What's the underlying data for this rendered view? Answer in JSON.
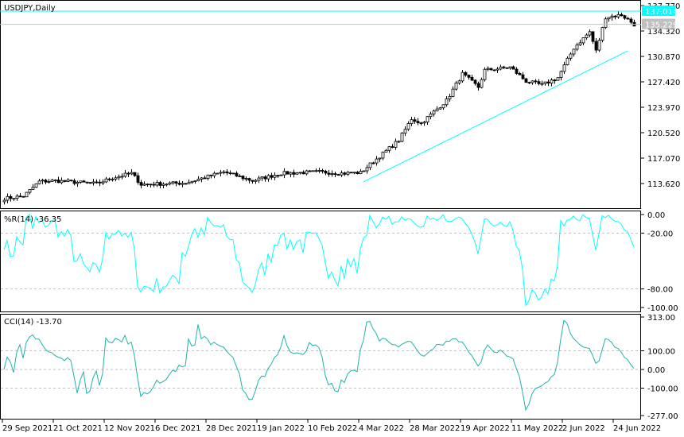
{
  "main": {
    "title": "USDJPY,Daily",
    "price_labels": [
      "137.770",
      "134.320",
      "130.870",
      "127.420",
      "123.970",
      "120.520",
      "117.070",
      "113.620"
    ],
    "price_values": [
      137.77,
      134.32,
      130.87,
      127.42,
      123.97,
      120.52,
      117.07,
      113.62
    ],
    "hline_price": {
      "label": "137.014",
      "value": 137.014
    },
    "current_price": {
      "label": "135.229",
      "value": 135.229
    },
    "trendline": {
      "from_bar": 113,
      "from_price": 113.85,
      "to_bar": 196,
      "to_price": 131.6
    },
    "price_keypoints": [
      [
        0,
        111.6
      ],
      [
        6,
        111.9
      ],
      [
        11,
        113.9
      ],
      [
        16,
        114.0
      ],
      [
        29,
        113.6
      ],
      [
        34,
        114.4
      ],
      [
        40,
        115.0
      ],
      [
        43,
        113.5
      ],
      [
        57,
        113.7
      ],
      [
        69,
        115.2
      ],
      [
        78,
        114.0
      ],
      [
        87,
        115.0
      ],
      [
        99,
        115.2
      ],
      [
        106,
        115.0
      ],
      [
        112,
        115.1
      ],
      [
        116,
        116.6
      ],
      [
        124,
        119.5
      ],
      [
        128,
        122.4
      ],
      [
        131,
        121.8
      ],
      [
        139,
        124.9
      ],
      [
        144,
        128.5
      ],
      [
        149,
        126.7
      ],
      [
        151,
        129.0
      ],
      [
        159,
        129.4
      ],
      [
        164,
        127.5
      ],
      [
        169,
        127.0
      ],
      [
        174,
        128.0
      ],
      [
        179,
        132.0
      ],
      [
        184,
        134.2
      ],
      [
        186,
        131.6
      ],
      [
        189,
        136.2
      ],
      [
        194,
        136.5
      ],
      [
        198,
        135.2
      ]
    ],
    "colors": {
      "accent": "#00ffff",
      "bull": "#ffffff",
      "bear": "#000000",
      "grid": "#c0c0c0"
    }
  },
  "wpr": {
    "title": "%R(14) -36.35",
    "levels": [
      "0.00",
      "-20.00",
      "-80.00",
      "-100.00"
    ]
  },
  "cci": {
    "title": "CCI(14) -13.70",
    "levels": [
      "313.00",
      "100.00",
      "0.00",
      "-100.00",
      "-277.00"
    ]
  },
  "time_axis": [
    "29 Sep 2021",
    "21 Oct 2021",
    "12 Nov 2021",
    "6 Dec 2021",
    "28 Dec 2021",
    "19 Jan 2022",
    "10 Feb 2022",
    "4 Mar 2022",
    "28 Mar 2022",
    "19 Apr 2022",
    "11 May 2022",
    "2 Jun 2022",
    "24 Jun 2022"
  ]
}
